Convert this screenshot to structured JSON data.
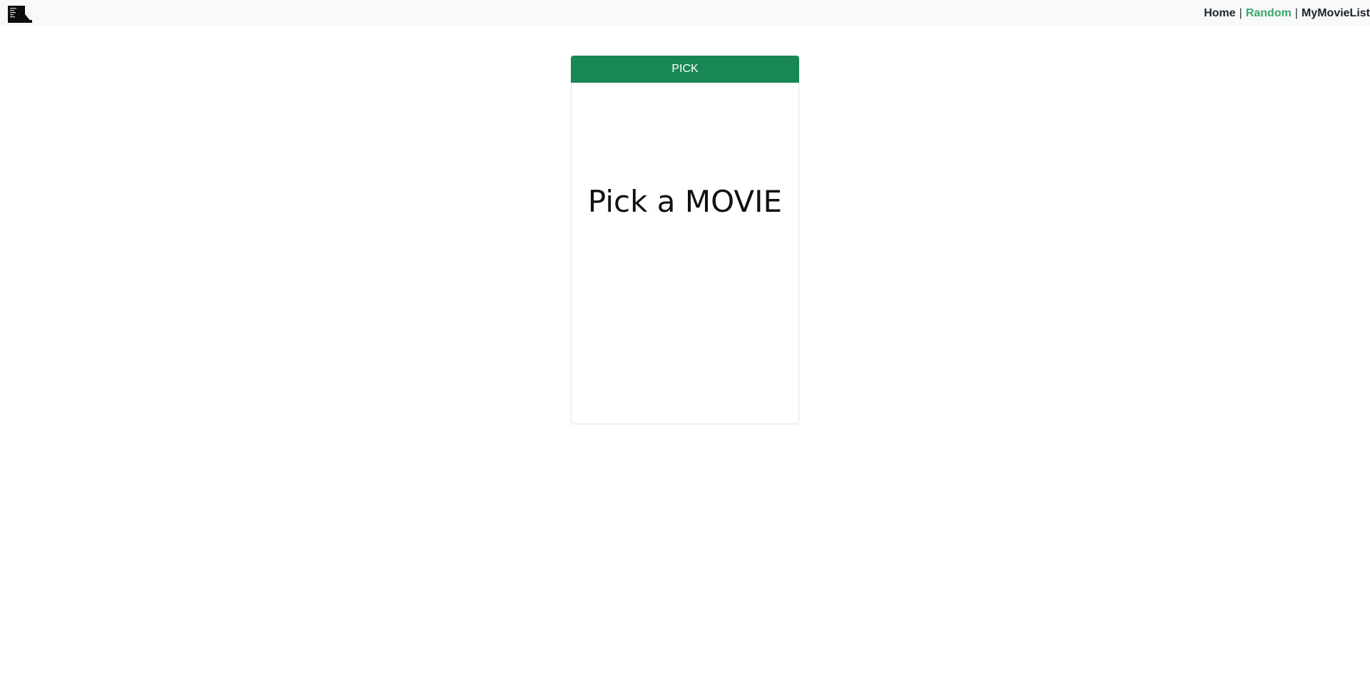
{
  "navbar": {
    "logo_icon": "film-logo-icon",
    "links": [
      {
        "label": "Home",
        "active": false
      },
      {
        "label": "Random",
        "active": true
      },
      {
        "label": "MyMovieList",
        "active": false
      }
    ],
    "separator": "|",
    "active_color": "#3aa86b",
    "background": "#f8f9fa"
  },
  "main": {
    "pick_button_label": "PICK",
    "pick_button_color": "#198754",
    "placeholder_text": "Pick a MOVIE"
  }
}
